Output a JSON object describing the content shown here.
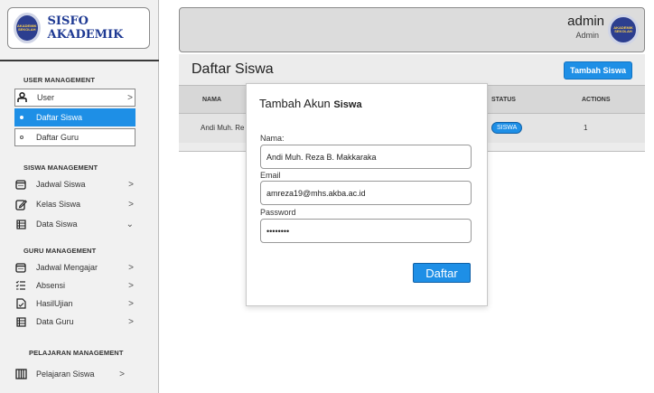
{
  "sidebar": {
    "brand": {
      "title": "SISFO AKADEMIK",
      "logo_text": "AKADEMIK SEKOLAH"
    },
    "sections": [
      {
        "title": "USER MANAGEMENT"
      },
      {
        "title": "SISWA MANAGEMENT"
      },
      {
        "title": "GURU MANAGEMENT"
      },
      {
        "title": "PELAJARAN MANAGEMENT"
      }
    ],
    "user_management": [
      {
        "label": "User",
        "icon": "user-icon",
        "chevron": ">"
      },
      {
        "label": "Daftar Siswa",
        "active": true
      },
      {
        "label": "Daftar Guru"
      }
    ],
    "siswa_management": [
      {
        "label": "Jadwal Siswa",
        "icon": "calendar-icon",
        "chevron": ">"
      },
      {
        "label": "Kelas Siswa",
        "icon": "edit-icon",
        "chevron": ">"
      },
      {
        "label": "Data Siswa",
        "icon": "list-icon",
        "chevron": "⌄"
      }
    ],
    "guru_management": [
      {
        "label": "Jadwal Mengajar",
        "icon": "calendar-icon",
        "chevron": ">"
      },
      {
        "label": "Absensi",
        "icon": "checklist-icon",
        "chevron": ">"
      },
      {
        "label": "HasilUjian",
        "icon": "document-icon",
        "chevron": ">"
      },
      {
        "label": "Data Guru",
        "icon": "list-icon",
        "chevron": ">"
      }
    ],
    "pelajaran_management": [
      {
        "label": "Pelajaran Siswa",
        "icon": "book-icon",
        "chevron": ">"
      }
    ]
  },
  "header": {
    "admin_name": "admin",
    "admin_role": "Admin",
    "avatar_text": "AKADEMIK SEKOLAH"
  },
  "main": {
    "title": "Daftar Siswa",
    "add_button": "Tambah Siswa",
    "columns": [
      "NAMA",
      "STATUS",
      "ACTIONS"
    ],
    "rows": [
      {
        "nama": "Andi Muh. Re",
        "status": "SISWA",
        "actions": "1"
      }
    ]
  },
  "modal": {
    "title_prefix": "Tambah Akun ",
    "title_bold": "Siswa",
    "fields": [
      {
        "label": "Nama:",
        "value": "Andi Muh. Reza B. Makkaraka"
      },
      {
        "label": "Email",
        "value": "amreza19@mhs.akba.ac.id"
      },
      {
        "label": "Password",
        "value": "••••••••"
      }
    ],
    "submit": "Daftar"
  },
  "colors": {
    "accent": "#1e8fe6",
    "brand_text": "#1f3a93",
    "sidebar_bg": "#f1f1f1",
    "header_bg": "#dcdcdc"
  }
}
